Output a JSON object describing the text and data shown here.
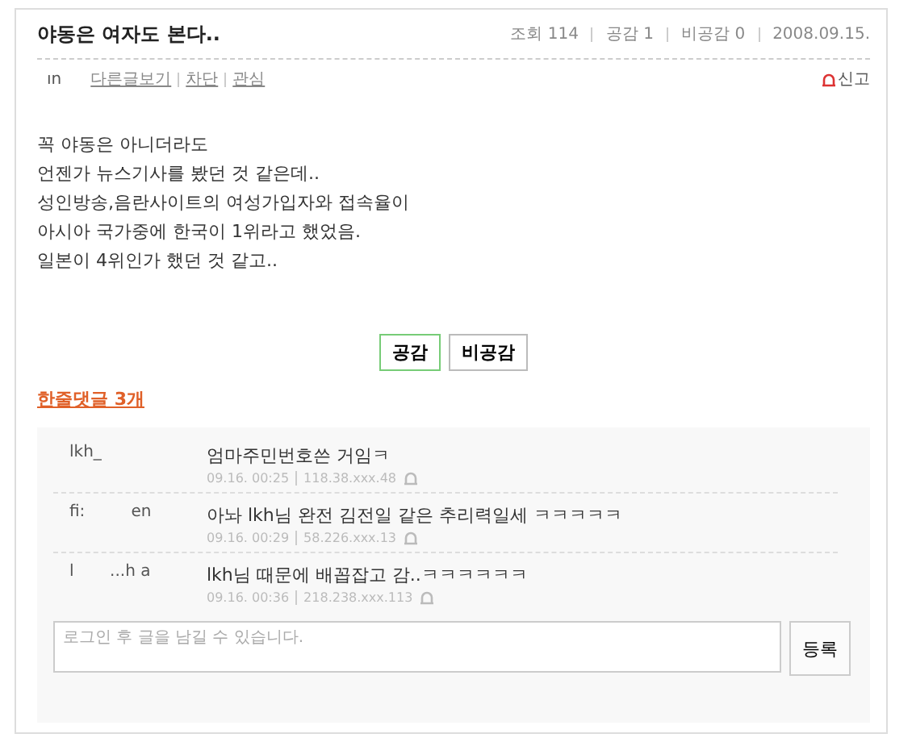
{
  "post": {
    "title": "야동은 여자도 본다..",
    "stats": [
      {
        "label": "조회 114"
      },
      {
        "label": "공감 1"
      },
      {
        "label": "비공감 0"
      },
      {
        "label": "2008.09.15."
      }
    ],
    "author": "ın",
    "author_links": [
      "다른글보기",
      "차단",
      "관심"
    ],
    "report": "신고",
    "body": [
      "꼭 야동은 아니더라도",
      "언젠가 뉴스기사를 봤던 것 같은데..",
      "성인방송,음란사이트의 여성가입자와 접속율이",
      "아시아 국가중에 한국이 1위라고 했었음.",
      "일본이 4위인가 했던 것 같고.."
    ],
    "votes": [
      {
        "label": "공감",
        "selected": true
      },
      {
        "label": "비공감",
        "selected": false
      }
    ]
  },
  "comments": {
    "heading": "한줄댓글 3개",
    "items": [
      {
        "name": "lkh_",
        "text": "엄마주민번호쓴 거임ㅋ",
        "time": "09.16. 00:25",
        "ip": "118.38.xxx.48"
      },
      {
        "name": "fi:         en",
        "text": "아놔 lkh님 완전 김전일 같은 추리력일세 ㅋㅋㅋㅋㅋ",
        "time": "09.16. 00:29",
        "ip": "58.226.xxx.13"
      },
      {
        "name": "l       ...h a",
        "text": "lkh님 때문에 배꼽잡고 감..ㅋㅋㅋㅋㅋㅋ",
        "time": "09.16. 00:36",
        "ip": "218.238.xxx.113"
      }
    ],
    "input": {
      "placeholder": "로그인 후 글을 남길 수 있습니다."
    },
    "submit": "등록"
  }
}
